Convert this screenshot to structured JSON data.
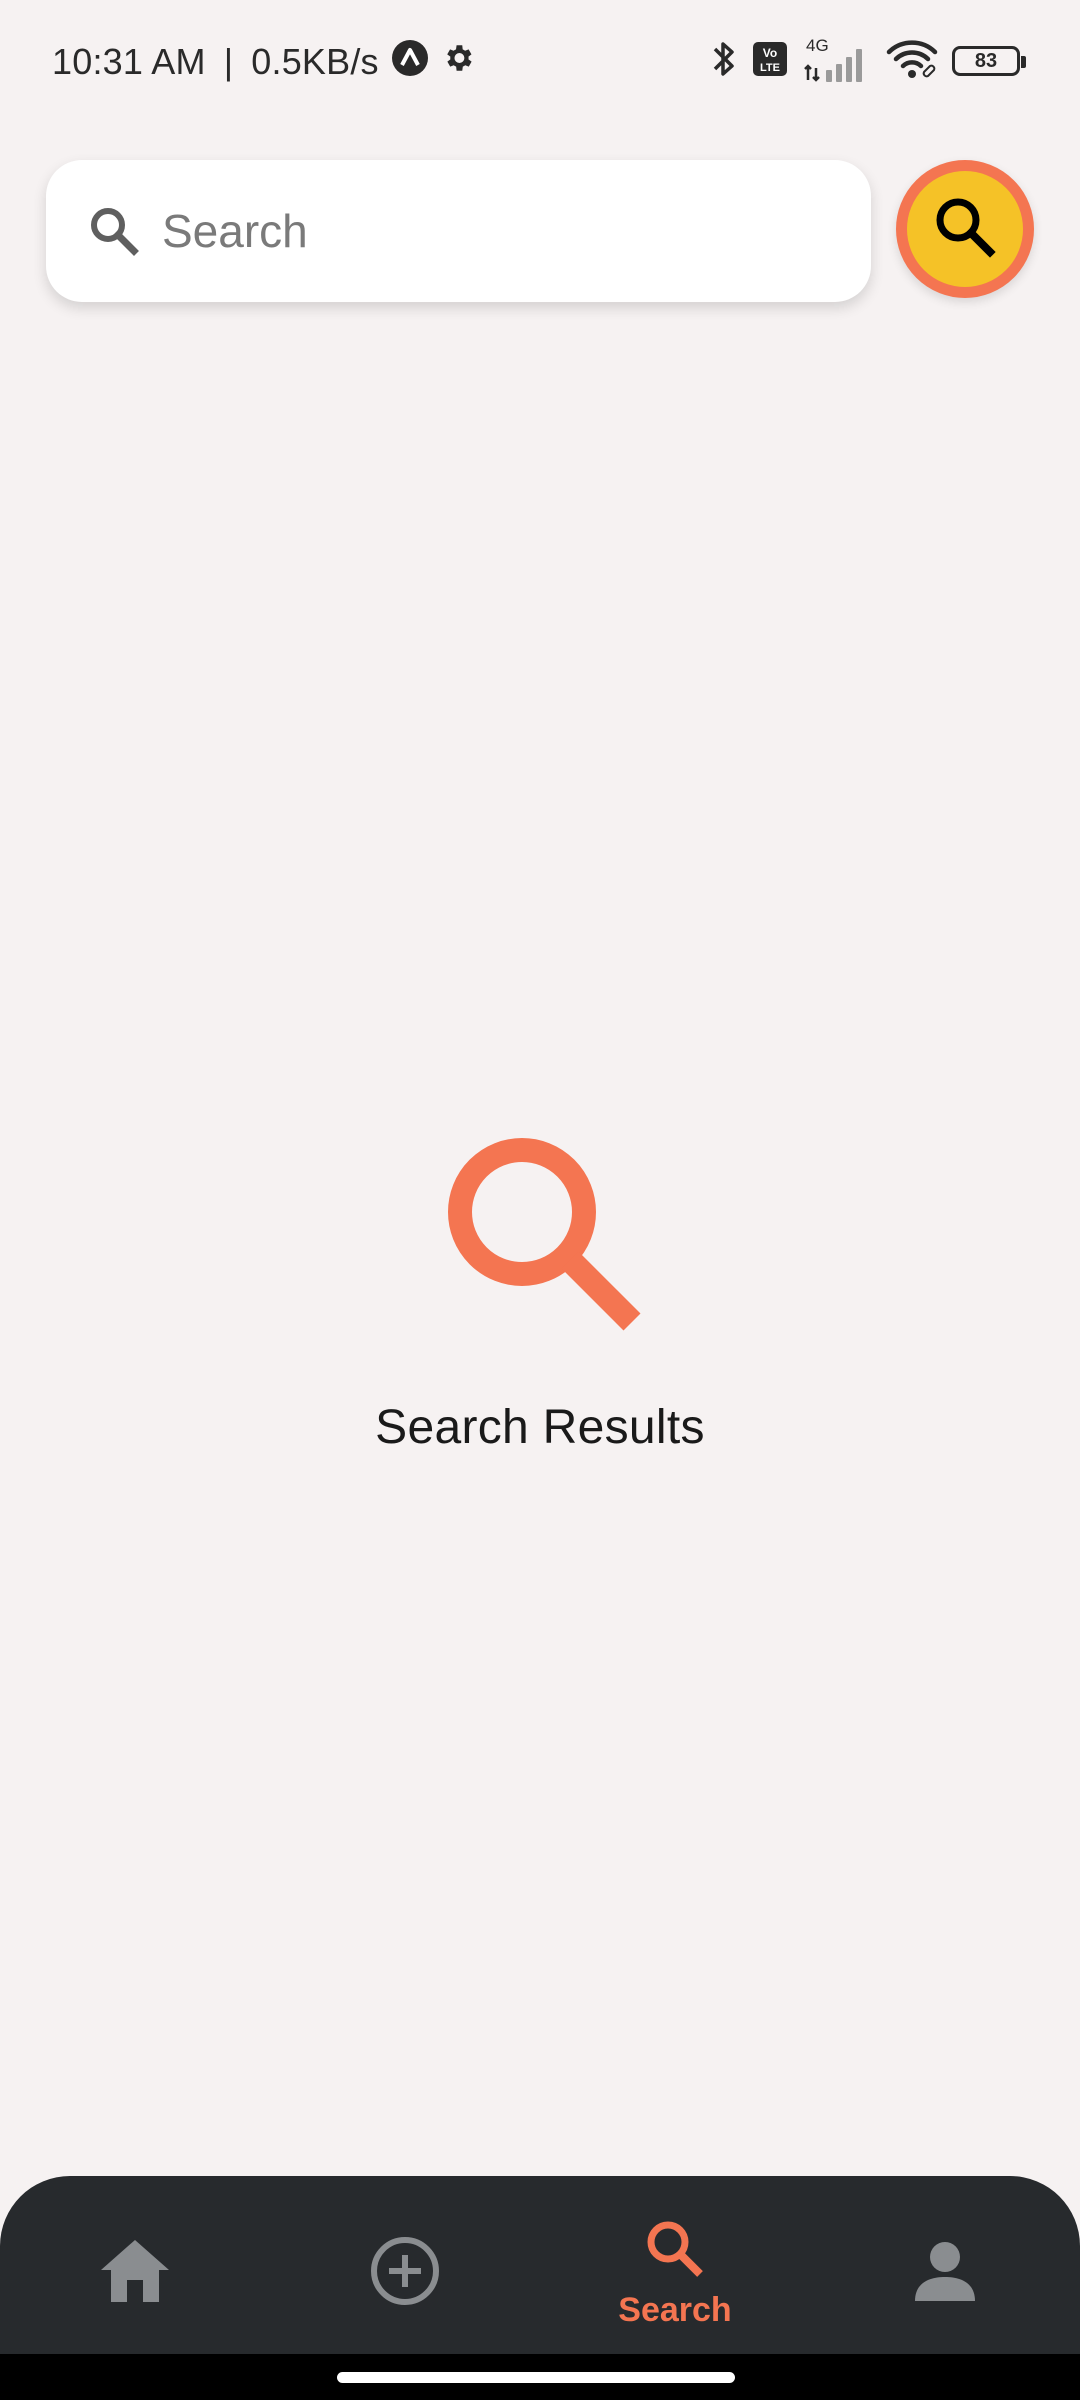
{
  "status_bar": {
    "time": "10:31 AM",
    "separator": "|",
    "network_speed": "0.5KB/s",
    "network_type": "4G",
    "volte_label": "Vo LTE",
    "battery_level": "83",
    "icons": [
      "app-notification-icon",
      "settings-gear-icon",
      "bluetooth-icon",
      "volte-icon",
      "cellular-signal-icon",
      "wifi-icon",
      "battery-icon"
    ]
  },
  "search": {
    "placeholder": "Search",
    "value": "",
    "leading_icon": "search-icon",
    "action_button_icon": "search-icon"
  },
  "empty_state": {
    "icon": "search-icon",
    "title": "Search Results"
  },
  "bottom_nav": {
    "items": [
      {
        "id": "home",
        "icon": "home-icon",
        "label": "",
        "active": false
      },
      {
        "id": "add",
        "icon": "add-circle-icon",
        "label": "",
        "active": false
      },
      {
        "id": "search",
        "icon": "search-icon",
        "label": "Search",
        "active": true
      },
      {
        "id": "profile",
        "icon": "person-icon",
        "label": "",
        "active": false
      }
    ]
  },
  "colors": {
    "background": "#f6f2f2",
    "accent": "#f47551",
    "fab_fill": "#f5c227",
    "nav_background": "#272a2d",
    "nav_inactive": "#8a8d90"
  }
}
